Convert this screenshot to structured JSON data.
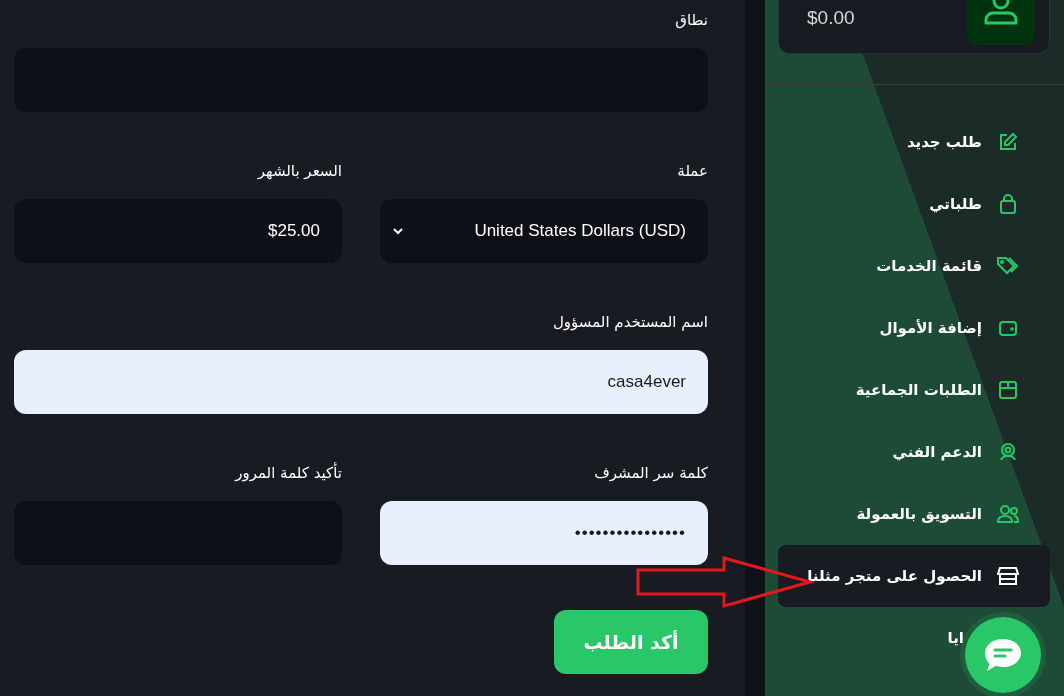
{
  "form": {
    "rows": [
      [
        {
          "label": "نطاق",
          "kind": "text",
          "light": false
        }
      ],
      [
        {
          "label": "عملة",
          "value": "United States Dollars (USD)",
          "kind": "select",
          "light": false
        },
        {
          "label": "السعر بالشهر",
          "value": "$25.00",
          "kind": "text",
          "light": false
        }
      ],
      [
        {
          "label": "اسم المستخدم المسؤول",
          "value": "casa4ever",
          "kind": "text",
          "light": true
        }
      ],
      [
        {
          "label": "كلمة سر المشرف",
          "value": "••••••••••••••••",
          "kind": "password",
          "light": true
        },
        {
          "label": "تأكيد كلمة المرور",
          "kind": "password",
          "light": false
        }
      ]
    ],
    "submit": "أكد الطلب"
  },
  "sidebar": {
    "balance": "$0.00",
    "items": [
      {
        "label": "طلب جديد",
        "selected": false
      },
      {
        "label": "طلباتي",
        "selected": false
      },
      {
        "label": "قائمة الخدمات",
        "selected": false
      },
      {
        "label": "إضافة الأموال",
        "selected": false
      },
      {
        "label": "الطلبات الجماعية",
        "selected": false
      },
      {
        "label": "الدعم الفني",
        "selected": false
      },
      {
        "label": "التسويق بالعمولة",
        "selected": false
      },
      {
        "label": "الحصول على متجر مثلنا",
        "selected": true
      },
      {
        "label": "ايا",
        "selected": false
      }
    ]
  }
}
